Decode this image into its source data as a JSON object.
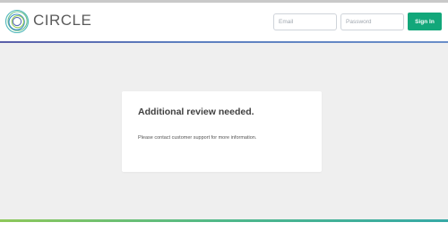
{
  "header": {
    "brand": "CIRCLE",
    "logo_icon": "circle-rings-logo",
    "email_placeholder": "Email",
    "password_placeholder": "Password",
    "signin_label": "Sign In"
  },
  "notice": {
    "title": "Additional review needed.",
    "message": "Please contact customer support for more information."
  },
  "colors": {
    "accent": "#12a77a",
    "brand_text": "#5b5b5b",
    "header_rule": "#5d7fbf",
    "footer_rule": "#4fb88a",
    "background": "#efefef"
  }
}
